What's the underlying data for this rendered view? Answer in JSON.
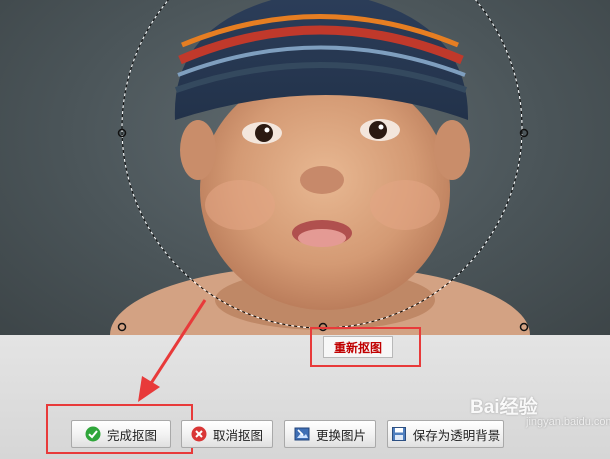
{
  "toolbar": {
    "redo_cutout_label": "重新抠图",
    "finish_cutout_label": "完成抠图",
    "cancel_cutout_label": "取消抠图",
    "replace_image_label": "更换图片",
    "save_transparent_label": "保存为透明背景"
  },
  "watermark": {
    "text": "Bai经验",
    "sub": "jingyan.baidu.com"
  },
  "colors": {
    "highlight_red": "#e83a3a",
    "redo_text_red": "#c00000",
    "backdrop_gray": "#4b5559"
  },
  "icons": {
    "finish": "green-check-icon",
    "cancel": "red-x-icon",
    "replace": "image-swap-icon",
    "save": "floppy-disk-icon"
  }
}
